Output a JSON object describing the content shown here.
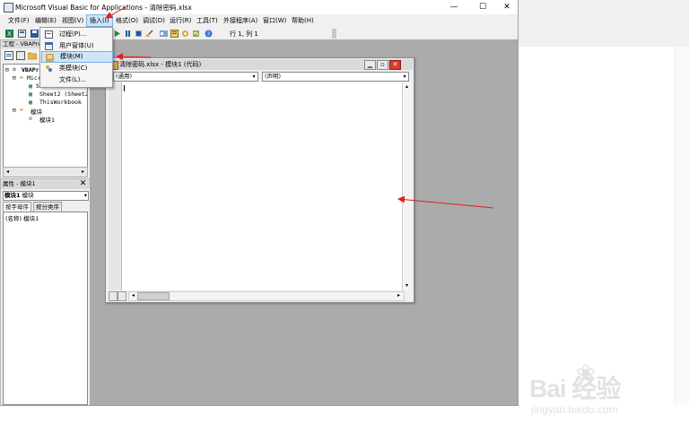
{
  "window": {
    "title": "Microsoft Visual Basic for Applications - 清除密码.xlsx",
    "minimize": "—",
    "maximize": "☐",
    "close": "✕"
  },
  "menubar": {
    "items": [
      {
        "label": "文件(F)"
      },
      {
        "label": "编辑(E)"
      },
      {
        "label": "视图(V)"
      },
      {
        "label": "插入(I)"
      },
      {
        "label": "格式(O)"
      },
      {
        "label": "调试(D)"
      },
      {
        "label": "运行(R)"
      },
      {
        "label": "工具(T)"
      },
      {
        "label": "外接程序(A)"
      },
      {
        "label": "窗口(W)"
      },
      {
        "label": "帮助(H)"
      }
    ]
  },
  "insert_menu": {
    "items": [
      {
        "label": "过程(P)..."
      },
      {
        "label": "用户窗体(U)"
      },
      {
        "label": "模块(M)"
      },
      {
        "label": "类模块(C)"
      },
      {
        "label": "文件(L)..."
      }
    ]
  },
  "toolbar": {
    "cursor_position": "行 1, 列 1"
  },
  "project_explorer": {
    "title": "工程 - VBAProje",
    "tree": [
      {
        "label": "VBAProj",
        "level": 0
      },
      {
        "label": "Micro",
        "level": 1
      },
      {
        "label": "S",
        "level": 2
      },
      {
        "label": "Sheet2 (Sheet2)",
        "level": 2
      },
      {
        "label": "ThisWorkbook",
        "level": 2
      },
      {
        "label": "模块",
        "level": 1
      },
      {
        "label": "模块1",
        "level": 2
      }
    ]
  },
  "properties": {
    "title": "属性 - 模块1",
    "close": "✕",
    "object_name": "模块1",
    "object_type": "模块",
    "tab_alpha": "按字母序",
    "tab_category": "按分类序",
    "row_name": "(名称)",
    "row_value": "模块1"
  },
  "code_window": {
    "title": "清除密码.xlsx - 模块1 (代码)",
    "object_combo": "(通用)",
    "proc_combo": "(声明)"
  },
  "watermark": {
    "brand": "Bai  经验",
    "url": "jingyan.baidu.com"
  },
  "colors": {
    "arrow": "#e02020",
    "mdi_background": "#ababab",
    "menu_highlight": "#cde5f7"
  }
}
